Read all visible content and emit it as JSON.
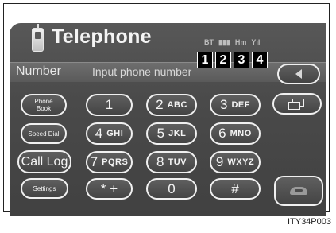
{
  "screen": {
    "title": "Telephone",
    "phone_icon": "mobile-phone-icon"
  },
  "status": {
    "bt": "BT",
    "battery": "▮▮▮",
    "home": "Hm",
    "signal": "Yıl"
  },
  "callouts": [
    "1",
    "2",
    "3",
    "4"
  ],
  "number_field": {
    "label": "Number",
    "placeholder": "Input phone number"
  },
  "side_buttons": {
    "phone_book_line1": "Phone",
    "phone_book_line2": "Book",
    "speed_dial": "Speed Dial",
    "call_log": "Call Log",
    "settings": "Settings"
  },
  "keypad": [
    {
      "digit": "1",
      "letters": ""
    },
    {
      "digit": "2",
      "letters": "ABC"
    },
    {
      "digit": "3",
      "letters": "DEF"
    },
    {
      "digit": "4",
      "letters": "GHI"
    },
    {
      "digit": "5",
      "letters": "JKL"
    },
    {
      "digit": "6",
      "letters": "MNO"
    },
    {
      "digit": "7",
      "letters": "PQRS"
    },
    {
      "digit": "8",
      "letters": "TUV"
    },
    {
      "digit": "9",
      "letters": "WXYZ"
    },
    {
      "digit": "* +",
      "letters": ""
    },
    {
      "digit": "0",
      "letters": ""
    },
    {
      "digit": "#",
      "letters": ""
    }
  ],
  "icons": {
    "back": "back-arrow-icon",
    "copy": "copy-icon",
    "call": "handset-icon"
  },
  "figure_code": "ITY34P003",
  "colors": {
    "screen_bg": "#4a4a4a",
    "button_border": "#f0f0f0",
    "callout_bg": "#000000"
  }
}
